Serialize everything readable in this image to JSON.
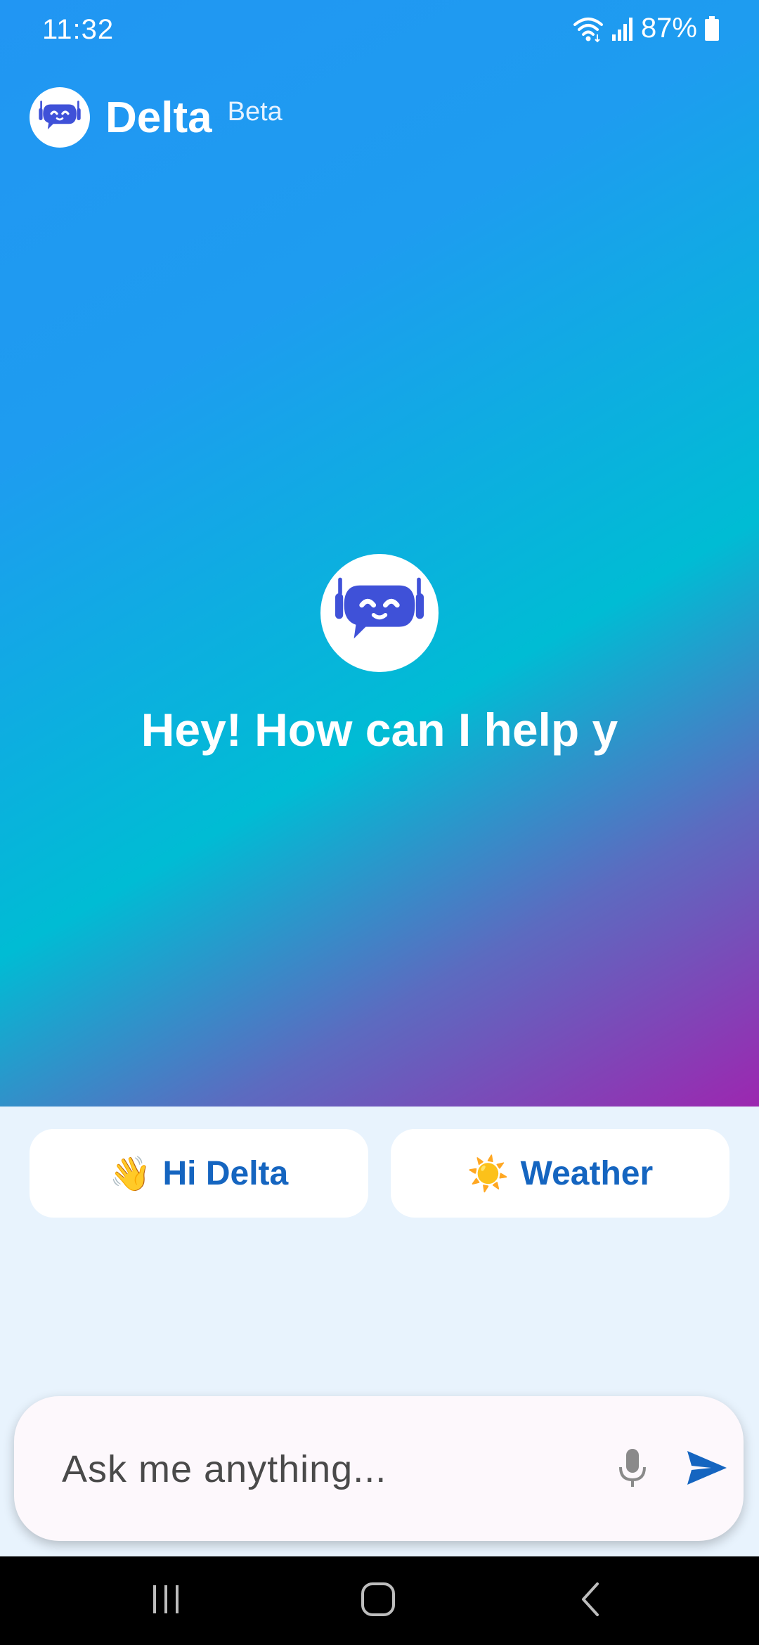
{
  "status_bar": {
    "time": "11:32",
    "battery_text": "87%"
  },
  "header": {
    "title": "Delta",
    "badge": "Beta"
  },
  "main": {
    "greeting": "Hey! How can I help y"
  },
  "suggestions": [
    {
      "emoji": "👋",
      "label": "Hi Delta"
    },
    {
      "emoji": "☀️",
      "label": "Weather"
    }
  ],
  "composer": {
    "placeholder": "Ask me anything..."
  },
  "icons": {
    "logo": "robot-chat-icon",
    "mic": "microphone-icon",
    "send": "send-icon"
  },
  "colors": {
    "accent": "#1565c0",
    "robot": "#3f51d8",
    "gradient_start": "#2196f3",
    "gradient_mid": "#00bcd4",
    "gradient_end": "#9c27b0",
    "panel_bg": "#e8f3fd"
  }
}
